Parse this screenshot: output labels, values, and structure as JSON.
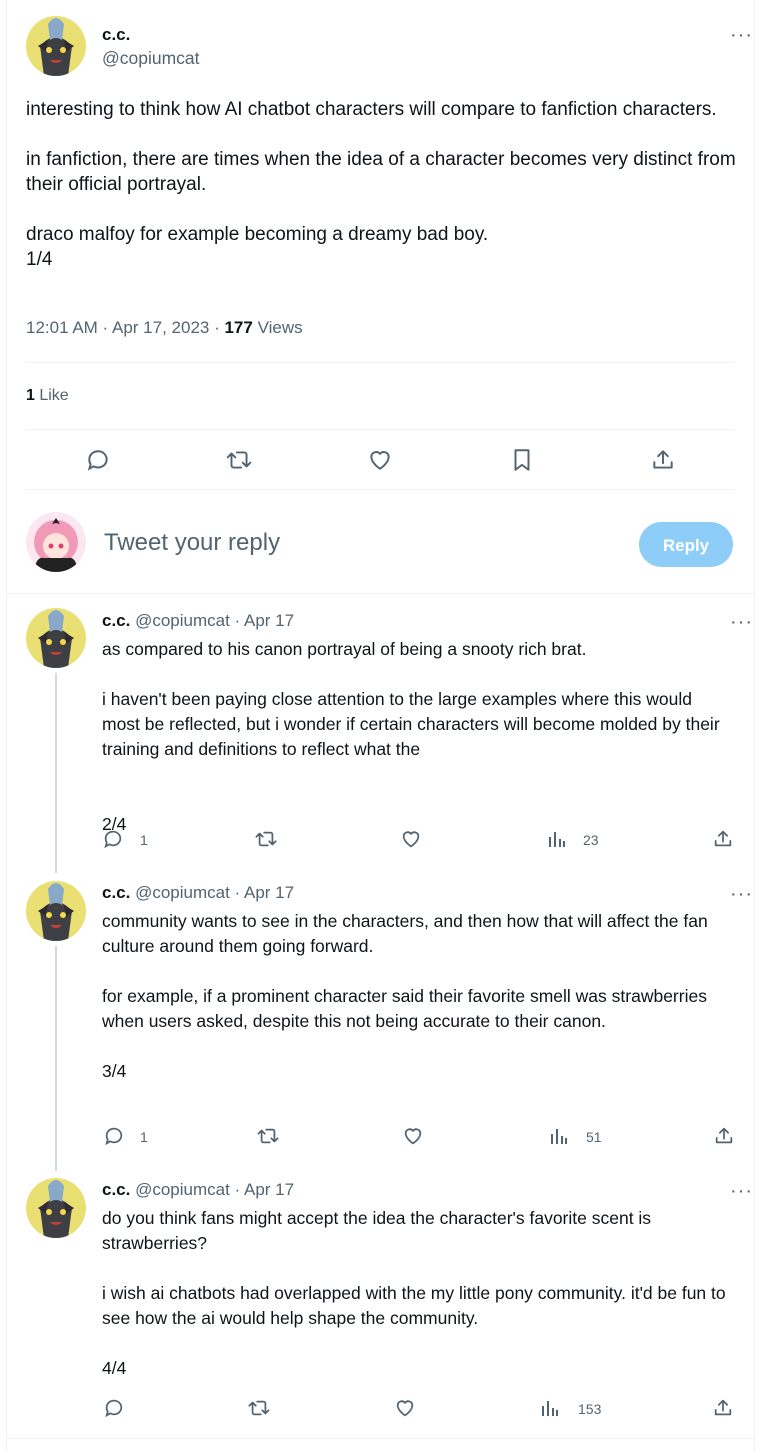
{
  "main_tweet": {
    "author_name": "c.c.",
    "handle": "@copiumcat",
    "more_label": "···",
    "text": "interesting to think how AI chatbot characters will compare to fanfiction characters.\n\nin fanfiction, there are times when the idea of a character becomes very distinct from their official portrayal.\n\ndraco malfoy for example becoming a dreamy bad boy.\n1/4",
    "time": "12:01 AM · Apr 17, 2023 · ",
    "views_count": "177",
    "views_label": " Views",
    "likes_count": "1",
    "likes_label": " Like",
    "actions": {
      "reply": "reply-icon",
      "retweet": "retweet-icon",
      "like": "heart-icon",
      "bookmark": "bookmark-icon",
      "share": "share-icon"
    }
  },
  "composer": {
    "placeholder": "Tweet your reply",
    "button": "Reply"
  },
  "replies": [
    {
      "name": "c.c.",
      "meta": "@copiumcat · Apr 17",
      "more": "···",
      "text": "as compared to his canon portrayal of being a snooty rich brat.\n\ni haven't been paying close attention to the large examples where this would most be reflected, but i wonder if certain characters will become molded by their training and definitions to reflect what the\n\n\n2/4",
      "reply_count": "1",
      "views": "23"
    },
    {
      "name": "c.c.",
      "meta": "@copiumcat · Apr 17",
      "more": "···",
      "text": "community wants to see in the characters, and then how that will affect the fan culture around them going forward.\n\nfor example, if a prominent character said their favorite smell was strawberries when users asked, despite this not being accurate to their canon.\n\n3/4",
      "reply_count": "1",
      "views": "51"
    },
    {
      "name": "c.c.",
      "meta": "@copiumcat · Apr 17",
      "more": "···",
      "text": "do you think fans might accept the idea the character's favorite scent is strawberries?\n\ni wish ai chatbots had overlapped with the my little pony community. it'd be fun to see how the ai would help shape the community.\n\n4/4",
      "reply_count": "",
      "views": "153"
    }
  ],
  "colors": {
    "accent": "#1d9bf0",
    "reply_button_disabled": "#8ecdf8",
    "muted": "#536471",
    "border": "#eff3f4"
  }
}
